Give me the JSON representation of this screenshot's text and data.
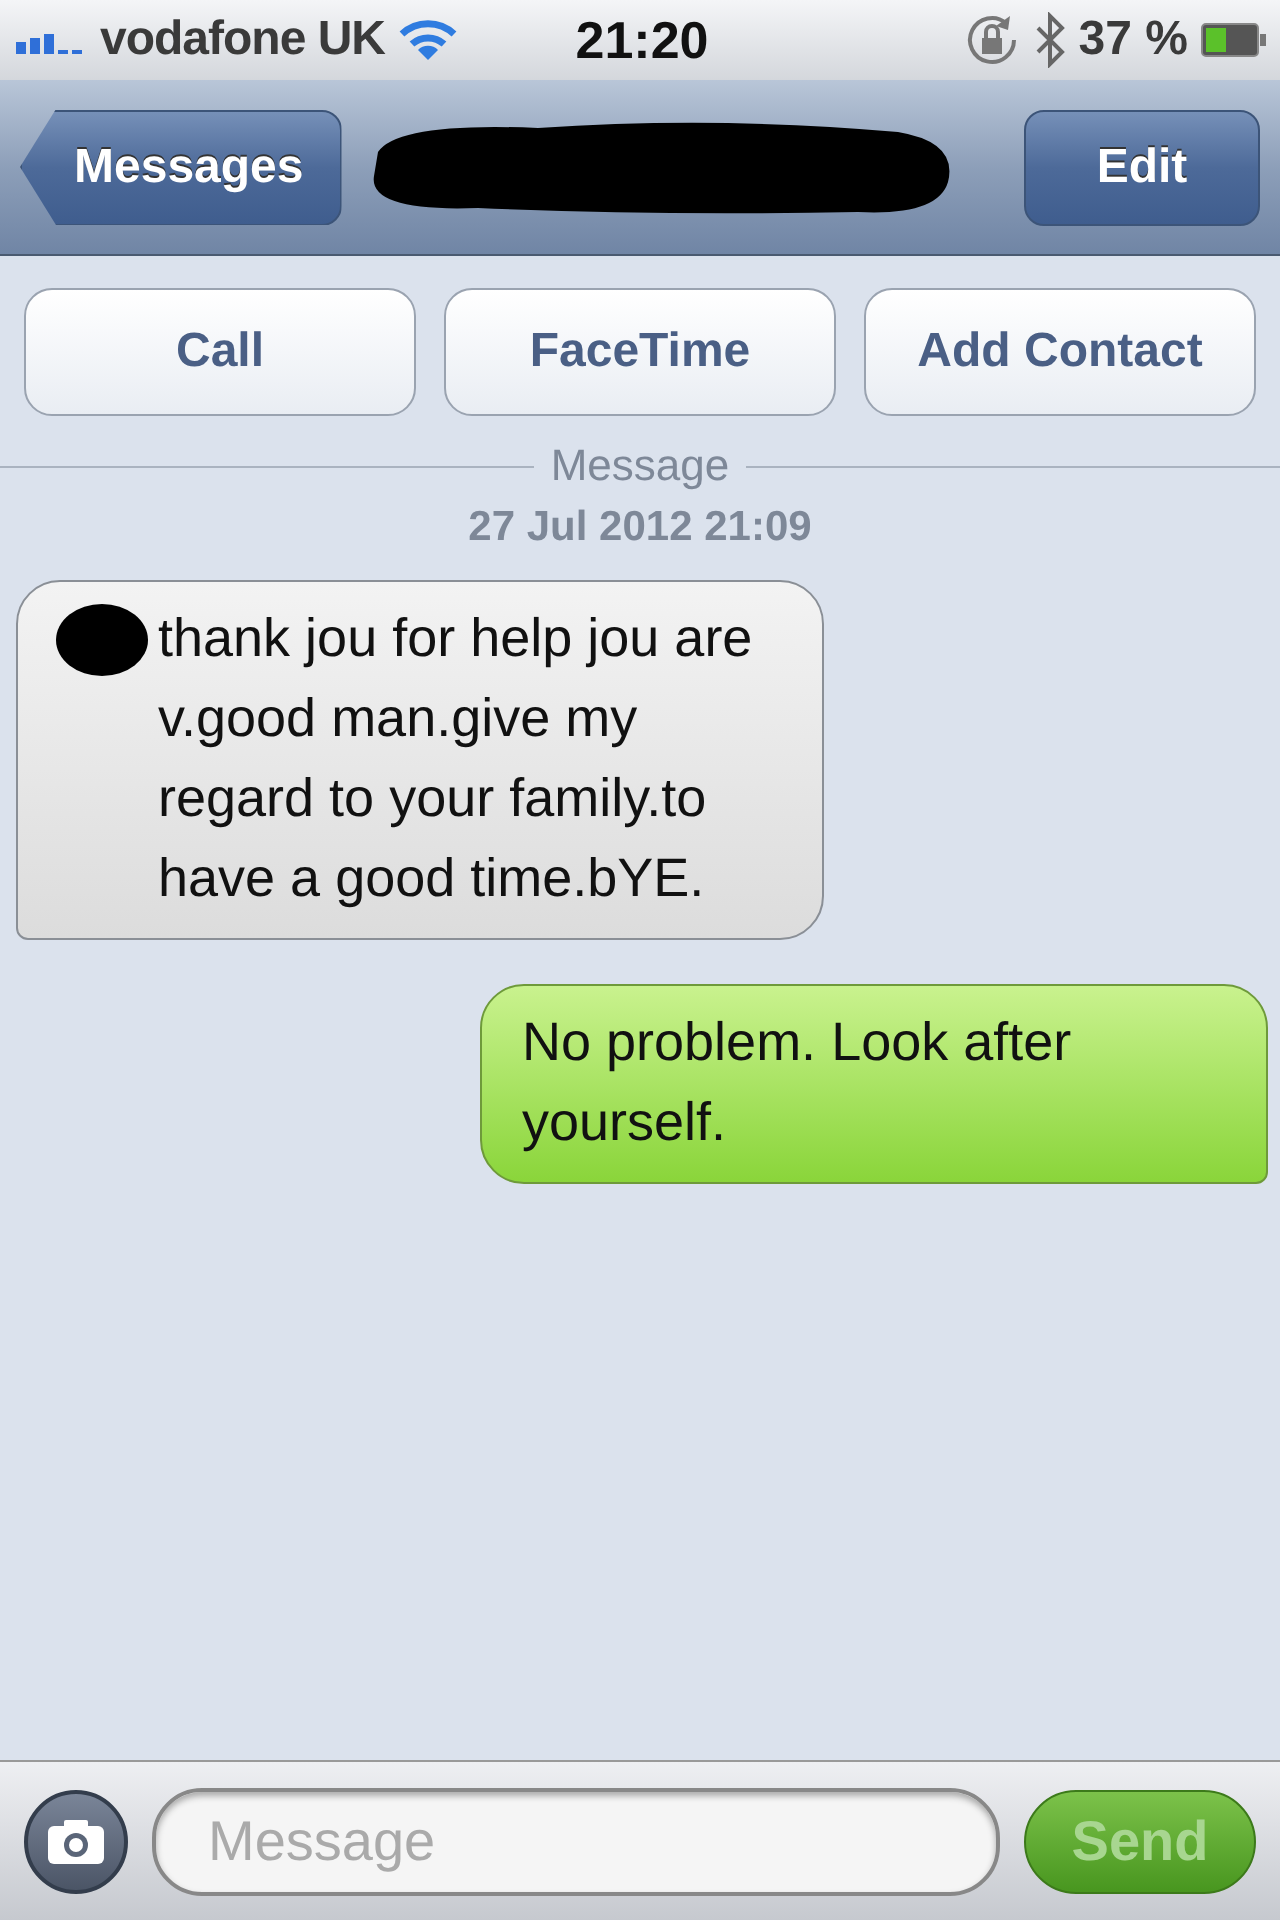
{
  "status_bar": {
    "carrier": "vodafone UK",
    "time": "21:20",
    "battery": "37 %"
  },
  "nav_bar": {
    "back": "Messages",
    "title_redacted": true,
    "edit": "Edit"
  },
  "actions": [
    {
      "label": "Call"
    },
    {
      "label": "FaceTime"
    },
    {
      "label": "Add Contact"
    }
  ],
  "divider": {
    "label": "Message"
  },
  "timestamp": "27 Jul 2012 21:09",
  "messages": [
    {
      "kind": "received",
      "redacted_start": true,
      "text": "thank jou for help jou are v.good man.give my regard to your family.to have a good time.bYE."
    },
    {
      "kind": "sent",
      "redacted_start": false,
      "text": "No problem. Look after yourself."
    }
  ],
  "composer": {
    "placeholder": "Message",
    "send": "Send",
    "send_disabled": true
  }
}
